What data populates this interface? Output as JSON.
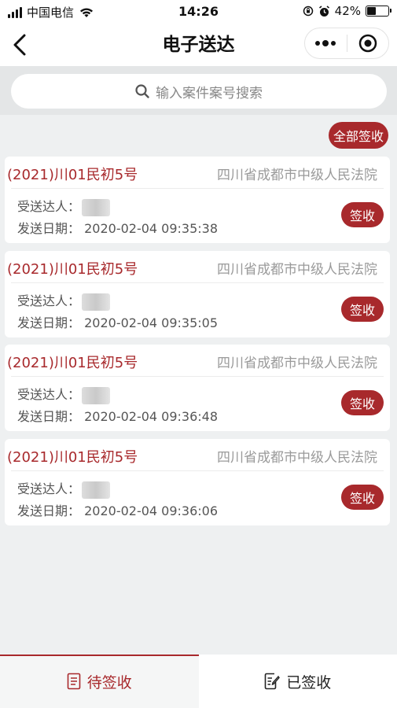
{
  "status_bar": {
    "carrier": "中国电信",
    "time": "14:26",
    "battery": "42%",
    "battery_level": 0.42
  },
  "nav": {
    "title": "电子送达"
  },
  "search": {
    "placeholder": "输入案件案号搜索"
  },
  "actions": {
    "sign_all_label": "全部签收"
  },
  "labels": {
    "recipient": "受送达人：",
    "send_date": "发送日期："
  },
  "cards": [
    {
      "case_no": "(2021)川01民初5号",
      "court": "四川省成都市中级人民法院",
      "date": "2020-02-04 09:35:38",
      "button": "签收"
    },
    {
      "case_no": "(2021)川01民初5号",
      "court": "四川省成都市中级人民法院",
      "date": "2020-02-04 09:35:05",
      "button": "签收"
    },
    {
      "case_no": "(2021)川01民初5号",
      "court": "四川省成都市中级人民法院",
      "date": "2020-02-04 09:36:48",
      "button": "签收"
    },
    {
      "case_no": "(2021)川01民初5号",
      "court": "四川省成都市中级人民法院",
      "date": "2020-02-04 09:36:06",
      "button": "签收"
    }
  ],
  "tabs": [
    {
      "label": "待签收",
      "icon": "document-list-icon",
      "active": true
    },
    {
      "label": "已签收",
      "icon": "document-edit-icon",
      "active": false
    }
  ],
  "colors": {
    "accent": "#a8292c",
    "background": "#eef0f1"
  }
}
